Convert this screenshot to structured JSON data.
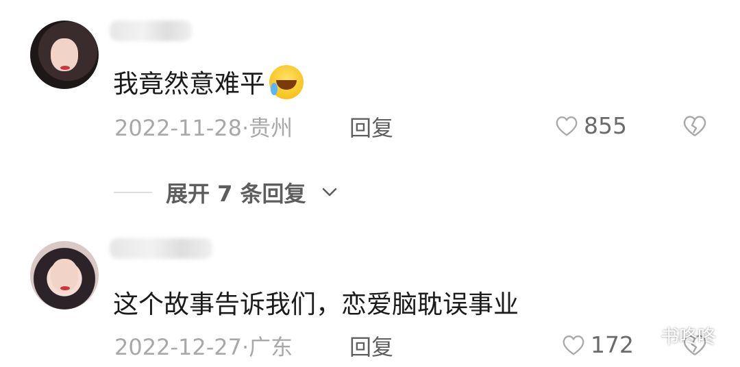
{
  "comments": [
    {
      "text": "我竟然意难平",
      "date": "2022-11-28",
      "location": "贵州",
      "reply_label": "回复",
      "likes": "855",
      "emoji_icon": "laughing-crying-emoji-icon"
    },
    {
      "text": "这个故事告诉我们，恋爱脑耽误事业",
      "date": "2022-12-27",
      "location": "广东",
      "reply_label": "回复",
      "likes": "172"
    }
  ],
  "expand_replies": {
    "label": "展开 7 条回复"
  },
  "watermark": {
    "text": "书咚咚",
    "icon": "wechat-icon"
  },
  "colors": {
    "text": "#1b1b1b",
    "meta": "#a8a8a8",
    "action": "#5e5e5e"
  }
}
